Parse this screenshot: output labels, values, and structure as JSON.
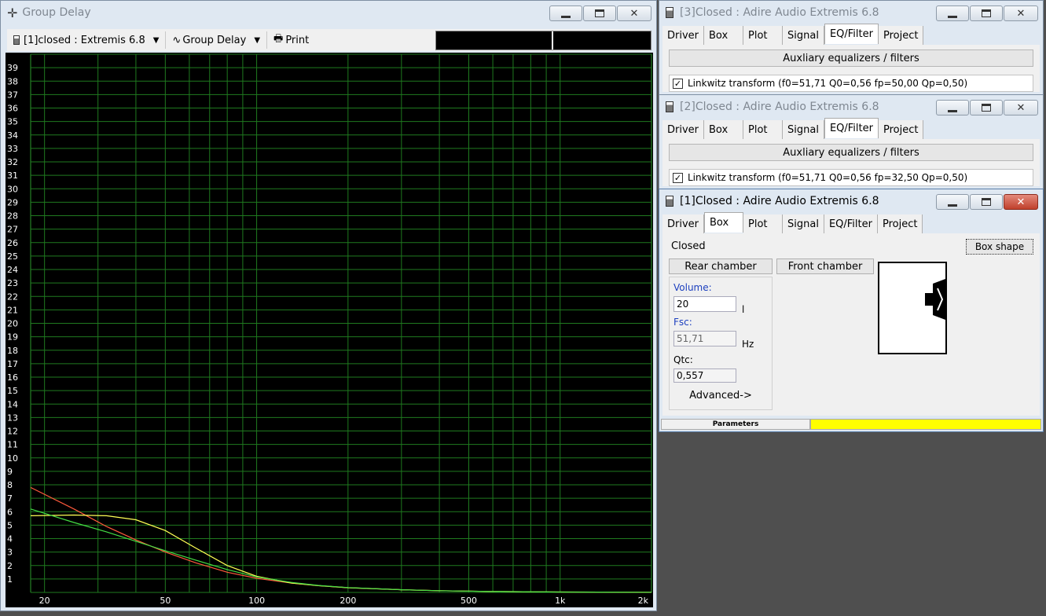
{
  "group_delay_window": {
    "title": "Group Delay",
    "project_select": "[1]closed : Extremis 6.8",
    "plot_type_select": "Group Delay",
    "print_label": "Print"
  },
  "chart_data": {
    "type": "line",
    "x_scale": "log",
    "xlim": [
      18,
      2000
    ],
    "ylim": [
      0,
      40
    ],
    "x_tick_labels": [
      "20",
      "50",
      "100",
      "200",
      "500",
      "1k",
      "2k"
    ],
    "x_tick_values": [
      20,
      50,
      100,
      200,
      500,
      1000,
      2000
    ],
    "y_tick_labels": [
      "1",
      "2",
      "3",
      "4",
      "5",
      "6",
      "7",
      "8",
      "9",
      "10",
      "11",
      "12",
      "13",
      "14",
      "15",
      "16",
      "17",
      "18",
      "19",
      "20",
      "21",
      "22",
      "23",
      "24",
      "25",
      "26",
      "27",
      "28",
      "29",
      "30",
      "31",
      "32",
      "33",
      "34",
      "35",
      "36",
      "37",
      "38",
      "39"
    ],
    "grid": true,
    "series": [
      {
        "color": "#ff5a3c",
        "x": [
          18,
          25,
          32,
          40,
          50,
          63,
          80,
          100,
          130,
          160,
          200,
          300,
          400,
          600,
          1000,
          2000
        ],
        "y": [
          7.8,
          6.2,
          4.9,
          3.9,
          3.0,
          2.2,
          1.5,
          1.05,
          0.7,
          0.5,
          0.35,
          0.2,
          0.13,
          0.07,
          0.03,
          0.01
        ]
      },
      {
        "color": "#ffff55",
        "x": [
          18,
          25,
          32,
          40,
          50,
          63,
          80,
          100,
          130,
          160,
          200,
          300,
          400,
          600,
          1000,
          2000
        ],
        "y": [
          5.7,
          5.75,
          5.7,
          5.4,
          4.6,
          3.3,
          2.0,
          1.2,
          0.7,
          0.5,
          0.35,
          0.2,
          0.13,
          0.07,
          0.03,
          0.01
        ]
      },
      {
        "color": "#44dd44",
        "x": [
          18,
          25,
          32,
          40,
          50,
          63,
          80,
          100,
          130,
          160,
          200,
          300,
          400,
          600,
          1000,
          2000
        ],
        "y": [
          6.2,
          5.2,
          4.5,
          3.8,
          3.1,
          2.4,
          1.7,
          1.15,
          0.75,
          0.52,
          0.36,
          0.2,
          0.13,
          0.07,
          0.03,
          0.01
        ]
      }
    ]
  },
  "win3": {
    "title": "[3]Closed : Adire Audio Extremis 6.8",
    "tabs": [
      "Driver",
      "Box",
      "Plot",
      "Signal",
      "EQ/Filter",
      "Project"
    ],
    "aux_label": "Auxliary equalizers / filters",
    "filter": "Linkwitz transform (f0=51,71 Q0=0,56 fp=50,00 Qp=0,50)",
    "check": "✓"
  },
  "win2": {
    "title": "[2]Closed : Adire Audio Extremis 6.8",
    "tabs": [
      "Driver",
      "Box",
      "Plot",
      "Signal",
      "EQ/Filter",
      "Project"
    ],
    "aux_label": "Auxliary equalizers / filters",
    "filter": "Linkwitz transform (f0=51,71 Q0=0,56 fp=32,50 Qp=0,50)",
    "check": "✓"
  },
  "win1": {
    "title": "[1]Closed : Adire Audio Extremis 6.8",
    "tabs": [
      "Driver",
      "Box",
      "Plot",
      "Signal",
      "EQ/Filter",
      "Project"
    ],
    "box_type": "Closed",
    "box_shape_label": "Box shape",
    "rear_chamber": "Rear chamber",
    "front_chamber": "Front chamber",
    "volume_label": "Volume:",
    "volume_value": "20",
    "volume_unit": "l",
    "fsc_label": "Fsc:",
    "fsc_value": "51,71",
    "fsc_unit": "Hz",
    "qtc_label": "Qtc:",
    "qtc_value": "0,557",
    "advanced_label": "Advanced->",
    "status_label": "Parameters"
  }
}
